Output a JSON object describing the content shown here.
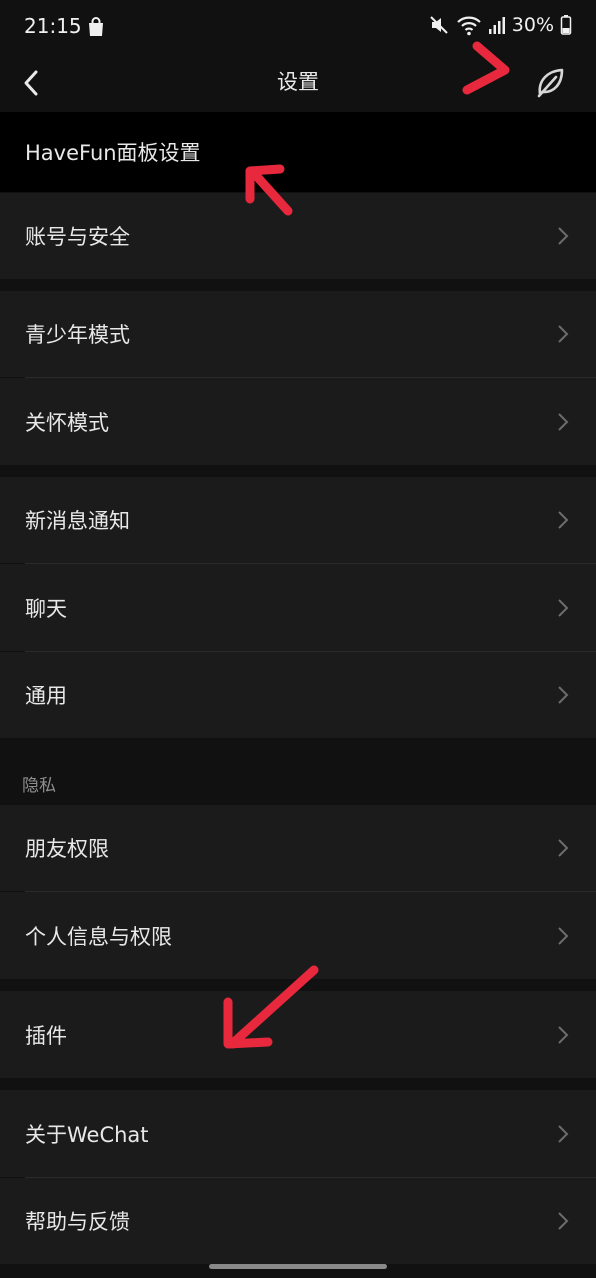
{
  "status_bar": {
    "time": "21:15",
    "battery": "30%",
    "icons": [
      "shopping-bag-icon",
      "mute-icon",
      "wifi-icon",
      "signal-icon",
      "battery-icon"
    ]
  },
  "nav": {
    "title": "设置",
    "back_icon": "chevron-left-icon",
    "right_icon": "leaf-icon"
  },
  "rows": {
    "havefun": "HaveFun面板设置",
    "account": "账号与安全",
    "youth": "青少年模式",
    "care": "关怀模式",
    "notify": "新消息通知",
    "chat": "聊天",
    "general": "通用",
    "friends": "朋友权限",
    "personal": "个人信息与权限",
    "plugins": "插件",
    "about": "关于WeChat",
    "help": "帮助与反馈"
  },
  "sections": {
    "privacy": "隐私"
  },
  "colors": {
    "background": "#111111",
    "row": "#1b1b1b",
    "highlight_row": "#000000",
    "annotation": "#e8283c"
  }
}
